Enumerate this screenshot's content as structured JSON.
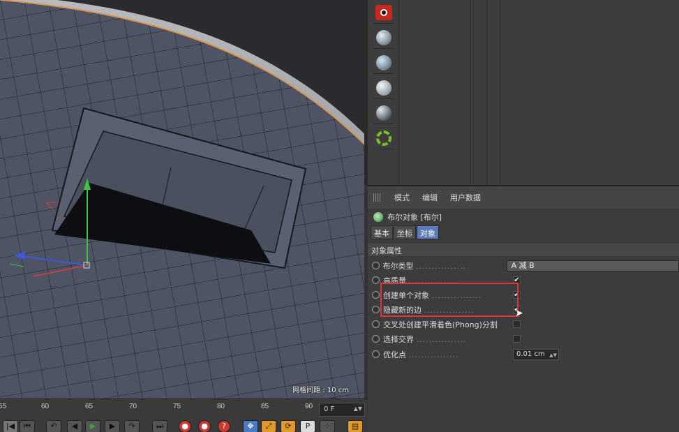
{
  "viewport": {
    "grid_info": "网格间距 : 10 cm"
  },
  "timeline": {
    "ticks": [
      "55",
      "60",
      "65",
      "70",
      "75",
      "80",
      "85",
      "90"
    ],
    "frame": "0 F"
  },
  "attributes": {
    "menu": [
      "模式",
      "编辑",
      "用户数据"
    ],
    "object_title": "布尔对象 [布尔]",
    "tabs": [
      "基本",
      "坐标",
      "对象"
    ],
    "section_title": "对象属性",
    "bool_type_label": "布尔类型",
    "bool_type_value": "A 减 B",
    "high_quality_label": "高质量",
    "create_single_label": "创建单个对象",
    "hide_new_edges_label": "隐藏新的边",
    "phong_label": "交叉处创建平滑着色(Phong)分割",
    "select_intersection_label": "选择交界",
    "optimize_label": "优化点",
    "optimize_value": "0.01 cm",
    "dots": "................"
  },
  "colors": {
    "accent": "#5b7ab8",
    "highlight": "#e3333c"
  },
  "icons": {
    "render_icon": "camera-icon",
    "material_icons": [
      "sphere-icon",
      "sphere-icon",
      "sphere-icon",
      "sphere-icon"
    ],
    "recycle_icon": "recycle-icon"
  }
}
